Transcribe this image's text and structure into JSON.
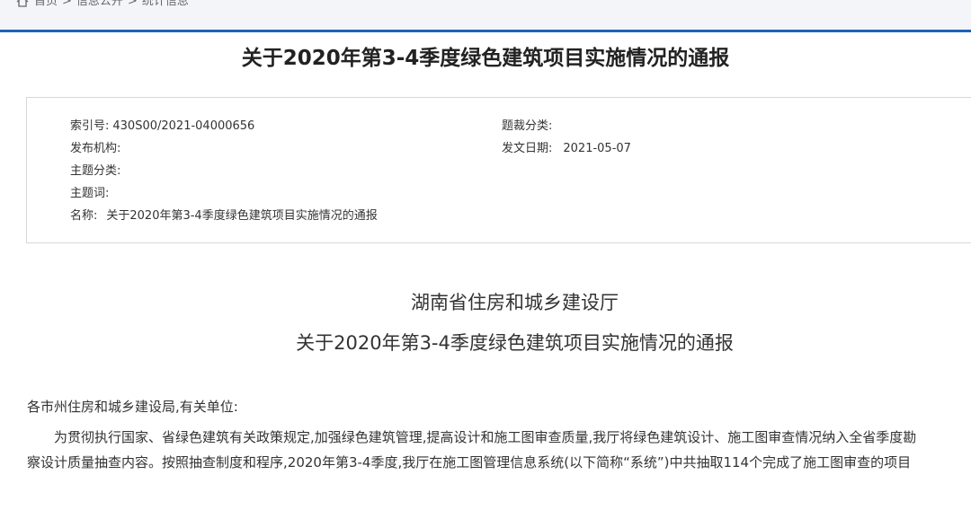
{
  "breadcrumb": {
    "items": [
      "首页",
      "信息公开",
      "统计信息"
    ],
    "separator": ">"
  },
  "document": {
    "title": "关于2020年第3-4季度绿色建筑项目实施情况的通报",
    "meta": {
      "index_label": "索引号:",
      "index_value": "430S00/2021-04000656",
      "category_label": "题裁分类:",
      "category_value": "",
      "publisher_label": "发布机构:",
      "publisher_value": "",
      "date_label": "发文日期:",
      "date_value": "2021-05-07",
      "topic_label": "主题分类:",
      "topic_value": "",
      "keyword_label": "主题词:",
      "keyword_value": "",
      "name_label": "名称:",
      "name_value": "关于2020年第3-4季度绿色建筑项目实施情况的通报"
    },
    "issuer": "湖南省住房和城乡建设厅",
    "subtitle": "关于2020年第3-4季度绿色建筑项目实施情况的通报",
    "salutation": "各市州住房和城乡建设局,有关单位:",
    "body_lines": [
      "为贯彻执行国家、省绿色建筑有关政策规定,加强绿色建筑管理,提高设计和施工图审查质量,我厅将绿色建筑设计、施工图审查情况纳入全省季度勘",
      "察设计质量抽查内容。按照抽查制度和程序,2020年第3-4季度,我厅在施工图管理信息系统(以下简称“系统”)中共抽取114个完成了施工图审查的项目"
    ]
  }
}
